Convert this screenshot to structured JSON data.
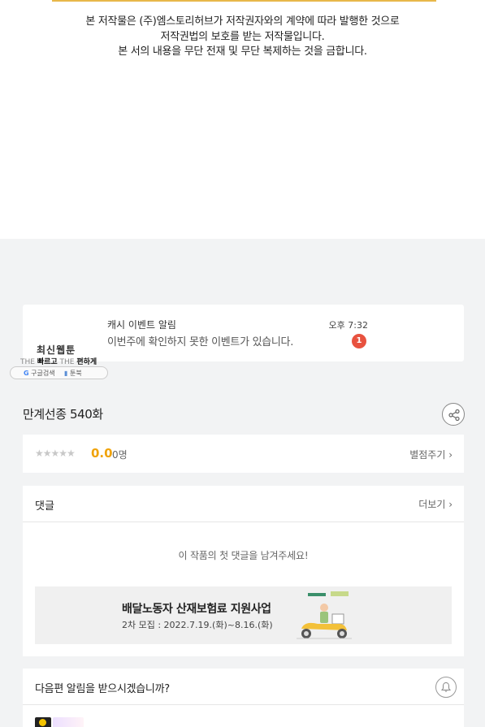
{
  "copyright": {
    "line1": "본 저작물은 (주)엠스토리허브가 저작권자와의 계약에 따라 발행한 것으로",
    "line2": "저작권법의 보호를 받는 저작물입니다.",
    "line3": "본 서의 내용을 무단 전재 및 무단 복제하는 것을 금합니다."
  },
  "notification": {
    "title": "캐시 이벤트 알림",
    "message": "이번주에 확인하지 못한 이벤트가 있습니다.",
    "time": "오후 7:32",
    "badge": "1"
  },
  "promo": {
    "title": "최신웹툰",
    "sub_the1": "THE",
    "sub_fast": "빠르고",
    "sub_the2": "THE",
    "sub_easy": "편하게",
    "search_label": "구글검색",
    "brand": "툰북"
  },
  "episode": {
    "title": "만계선종 540화"
  },
  "rating": {
    "stars": "★★★★★",
    "score": "0.0",
    "count": "0명",
    "rate_link": "별점주기 ›"
  },
  "comments": {
    "title": "댓글",
    "more": "더보기 ›",
    "empty": "이 작품의 첫 댓글을 남겨주세요!"
  },
  "banner": {
    "title": "배달노동자 산재보험료 지원사업",
    "subtitle": "2차 모집 : 2022.7.19.(화)~8.16.(화)"
  },
  "next_alert": {
    "title": "다음편 알림을 받으시겠습니까?"
  },
  "colors": {
    "accent_score": "#f0a30a",
    "badge": "#e8523f",
    "page_bg": "#f2f3f4"
  }
}
